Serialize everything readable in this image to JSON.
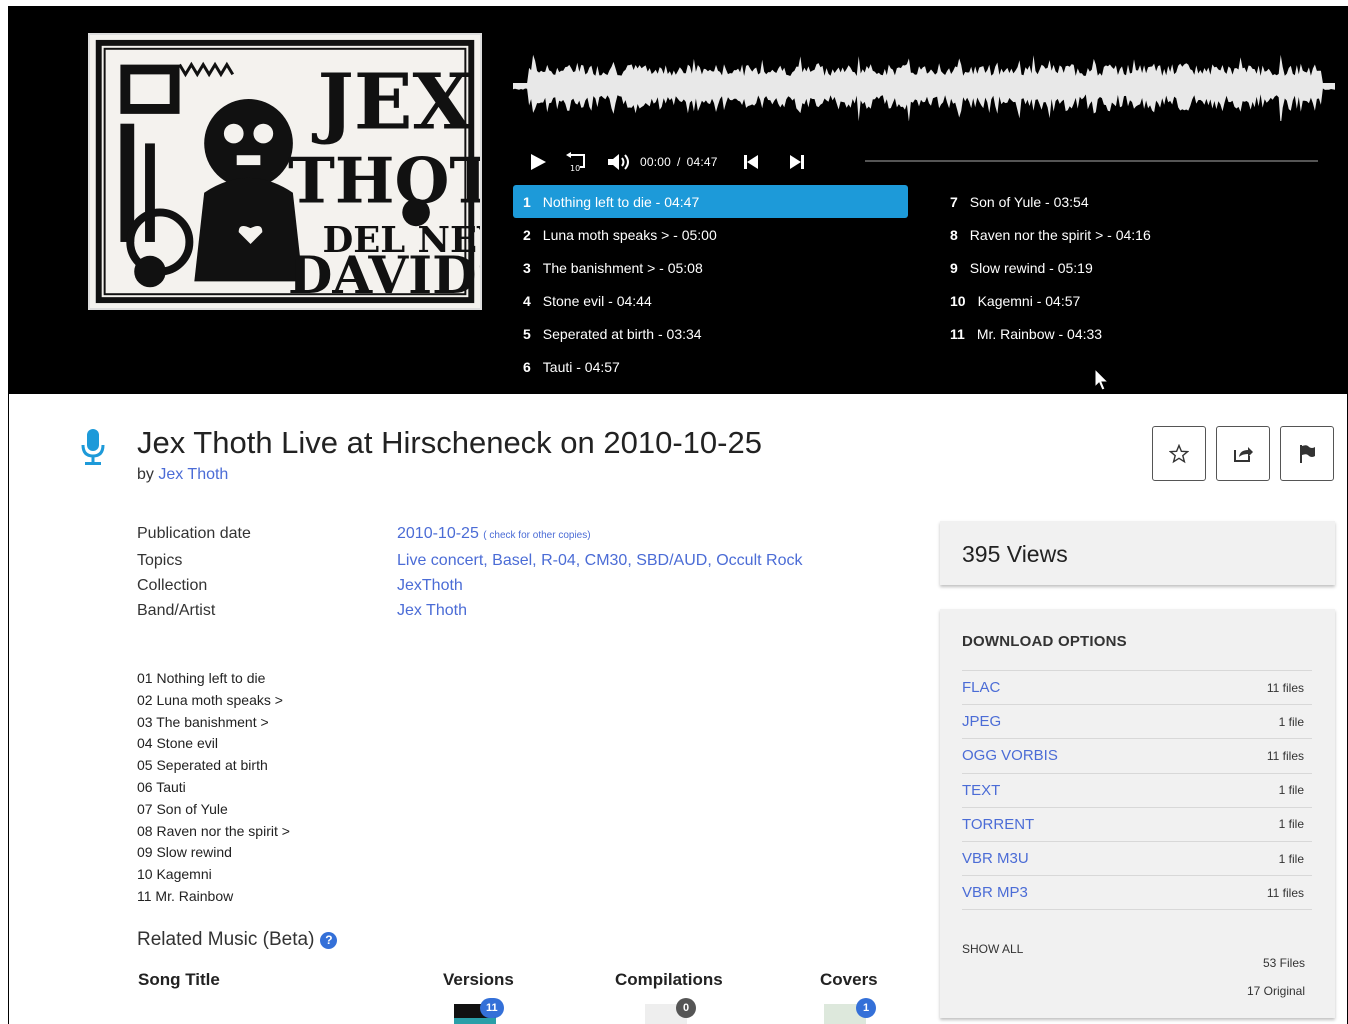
{
  "player": {
    "time_current": "00:00",
    "time_sep": "/",
    "time_total": "04:47",
    "progress": 0,
    "tracks_col1": [
      {
        "num": "1",
        "label": "Nothing left to die  - 04:47",
        "active": true
      },
      {
        "num": "2",
        "label": "Luna moth speaks >  - 05:00",
        "active": false
      },
      {
        "num": "3",
        "label": "The banishment >  - 05:08",
        "active": false
      },
      {
        "num": "4",
        "label": "Stone evil  - 04:44",
        "active": false
      },
      {
        "num": "5",
        "label": "Seperated at birth  - 03:34",
        "active": false
      },
      {
        "num": "6",
        "label": "Tauti  - 04:57",
        "active": false
      }
    ],
    "tracks_col2": [
      {
        "num": "7",
        "label": "Son of Yule  - 03:54"
      },
      {
        "num": "8",
        "label": "Raven nor the spirit >  - 04:16"
      },
      {
        "num": "9",
        "label": "Slow rewind  - 05:19"
      },
      {
        "num": "10",
        "label": "Kagemni  - 04:57"
      },
      {
        "num": "11",
        "label": "Mr. Rainbow  - 04:33"
      }
    ],
    "accent": "#1d9ad9"
  },
  "header": {
    "title": "Jex Thoth Live at Hirscheneck on 2010-10-25",
    "by_prefix": "by",
    "artist": "Jex Thoth",
    "media_icon": "microphone-icon"
  },
  "actions": {
    "favorite_icon": "star-icon",
    "share_icon": "share-icon",
    "flag_icon": "flag-icon"
  },
  "metadata": {
    "pubdate_label": "Publication date",
    "pubdate_value": "2010-10-25",
    "pubdate_note": "( check for other copies)",
    "topics_label": "Topics",
    "topics_value": "Live concert, Basel, R-04, CM30, SBD/AUD, Occult Rock",
    "collection_label": "Collection",
    "collection_value": "JexThoth",
    "artist_label": "Band/Artist",
    "artist_value": "Jex Thoth"
  },
  "tracklist": [
    "01 Nothing left to die",
    "02 Luna moth speaks >",
    "03 The banishment >",
    "04 Stone evil",
    "05 Seperated at birth",
    "06 Tauti",
    "07 Son of Yule",
    "08 Raven nor the spirit >",
    "09 Slow rewind",
    "10 Kagemni",
    "11 Mr. Rainbow"
  ],
  "related": {
    "title": "Related Music (Beta)",
    "help_glyph": "?",
    "col_song": "Song Title",
    "col_versions": "Versions",
    "col_compilations": "Compilations",
    "col_covers": "Covers",
    "versions_count": "11",
    "compilations_count": "0",
    "covers_count": "1"
  },
  "views": {
    "label": "395 Views"
  },
  "downloads": {
    "title": "DOWNLOAD OPTIONS",
    "items": [
      {
        "format": "FLAC",
        "count": "11 files"
      },
      {
        "format": "JPEG",
        "count": "1 file"
      },
      {
        "format": "OGG VORBIS",
        "count": "11 files"
      },
      {
        "format": "TEXT",
        "count": "1 file"
      },
      {
        "format": "TORRENT",
        "count": "1 file"
      },
      {
        "format": "VBR M3U",
        "count": "1 file"
      },
      {
        "format": "VBR MP3",
        "count": "11 files"
      }
    ],
    "show_all": "SHOW ALL",
    "total_files": "53 Files",
    "original": "17 Original"
  }
}
